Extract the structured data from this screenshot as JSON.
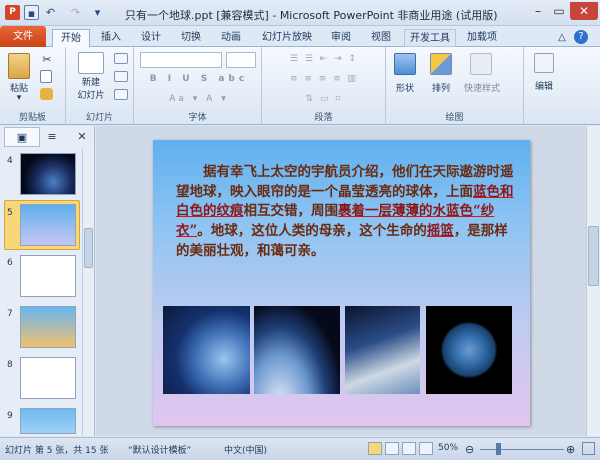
{
  "window": {
    "title": "只有一个地球.ppt [兼容模式] - Microsoft PowerPoint 非商业用途 (试用版)"
  },
  "tabs": [
    "文件",
    "开始",
    "插入",
    "设计",
    "切换",
    "动画",
    "幻灯片放映",
    "审阅",
    "视图",
    "开发工具",
    "加载项"
  ],
  "active_tab": "开始",
  "ribbon": {
    "groups": {
      "clipboard": "剪贴板",
      "slides": "幻灯片",
      "font": "字体",
      "paragraph": "段落",
      "drawing": "绘图"
    },
    "paste_label": "粘贴",
    "new_slide_label": "新建\n幻灯片",
    "shape_label": "形状",
    "arrange_label": "排列",
    "quickstyle_label": "快速样式",
    "edit_label": "编辑"
  },
  "slide_panel": {
    "slide_numbers": [
      "4",
      "5",
      "6",
      "7",
      "8",
      "9"
    ],
    "selected": "5"
  },
  "slide": {
    "text_runs": [
      {
        "text": "据有幸飞上太空的宇航员介绍，他们在天际遨游时遥望地球，映入眼帘的是一个晶莹透亮的球体，上面",
        "u": false
      },
      {
        "text": "蓝色和白色的纹痕",
        "u": true
      },
      {
        "text": "相互交错，周围",
        "u": false
      },
      {
        "text": "裹着一层",
        "u": true
      },
      {
        "text": "薄薄的水蓝色“纱衣”",
        "u": true
      },
      {
        "text": "。地球，这位人类的母亲，这个生命的",
        "u": false
      },
      {
        "text": "摇篮",
        "u": true
      },
      {
        "text": "，是那样的美丽壮观，和蔼可亲。",
        "u": false
      }
    ],
    "photos": [
      "earth-clouds-photo",
      "earth-from-orbit-photo",
      "astronaut-orbit-photo",
      "full-earth-photo"
    ]
  },
  "status": {
    "slide_info": "幻灯片 第 5 张，共 15 张",
    "theme": "“默认设计模板”",
    "lang": "中文(中国)",
    "zoom": "50%"
  },
  "colors": {
    "file_tab": "#d9531e",
    "slide_text": "#6b2a10",
    "underline": "#c81c1c"
  }
}
